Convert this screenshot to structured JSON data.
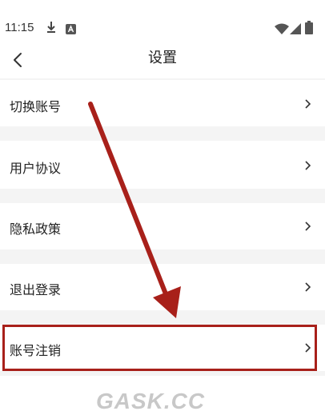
{
  "status_bar": {
    "time": "11:15",
    "icons": [
      "download-icon",
      "notification-a-icon",
      "wifi-icon",
      "signal-icon",
      "battery-icon"
    ]
  },
  "header": {
    "title": "设置",
    "back_icon": "chevron-left-icon"
  },
  "settings": {
    "items": [
      {
        "label": "切换账号"
      },
      {
        "label": "用户协议"
      },
      {
        "label": "隐私政策"
      },
      {
        "label": "退出登录"
      },
      {
        "label": "账号注销"
      }
    ]
  },
  "annotation": {
    "arrow_color": "#a8201a",
    "highlight_color": "#a8201a"
  },
  "watermark": {
    "text": "GASK.CC"
  }
}
